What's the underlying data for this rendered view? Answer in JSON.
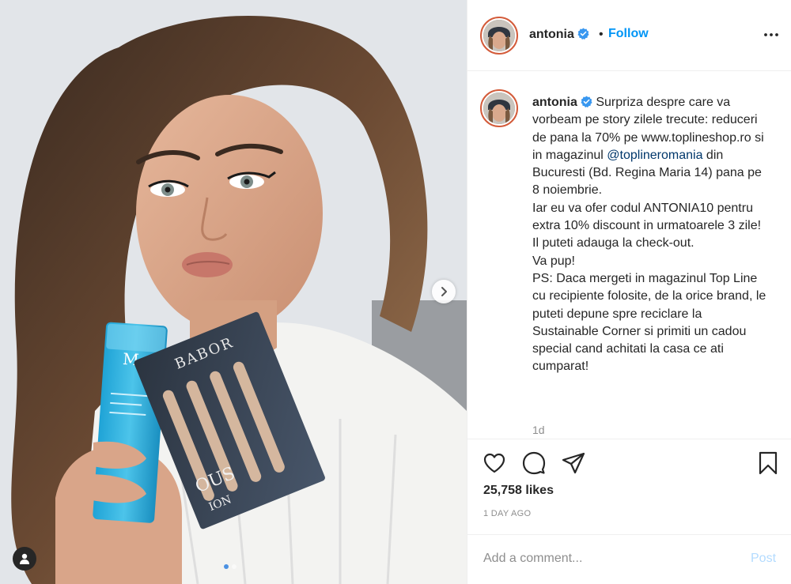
{
  "post": {
    "username": "antonia",
    "follow_label": "Follow",
    "separator": "•",
    "caption": {
      "part1": "Surpriza despre care va vorbeam pe story zilele trecute: reduceri de pana la 70% pe www.toplineshop.ro si in magazinul ",
      "mention": "@toplineromania",
      "part2": " din Bucuresti (Bd. Regina Maria 14) pana pe 8 noiembrie.",
      "line2": "Iar eu va ofer codul ANTONIA10 pentru extra 10% discount in urmatoarele 3 zile! Il puteti adauga la check-out.",
      "line3": "Va pup!",
      "line4": "PS: Daca mergeti in magazinul Top Line cu recipiente folosite, de la orice brand, le puteti depune spre reciclare la Sustainable Corner si primiti un cadou special cand achitati la casa ce ati cumparat!"
    },
    "time_short": "1d",
    "likes": "25,758 likes",
    "time_long": "1 DAY AGO"
  },
  "comment": {
    "placeholder": "Add a comment...",
    "post_label": "Post"
  },
  "product_labels": {
    "babor": "BABOR",
    "box_text": "OUS",
    "box_text2": "ION",
    "tube_logo": "M"
  },
  "carousel": {
    "total": 2,
    "active": 1
  },
  "icons": [
    "verified-badge-icon",
    "more-options-icon",
    "heart-icon",
    "comment-icon",
    "share-icon",
    "bookmark-icon",
    "chevron-right-icon",
    "user-tag-icon"
  ],
  "colors": {
    "accent": "#0095f6",
    "verified": "#3897f0",
    "avatar_ring": "#d35b3a",
    "post_disabled": "#b3dbff",
    "muted": "#8e8e8e"
  }
}
